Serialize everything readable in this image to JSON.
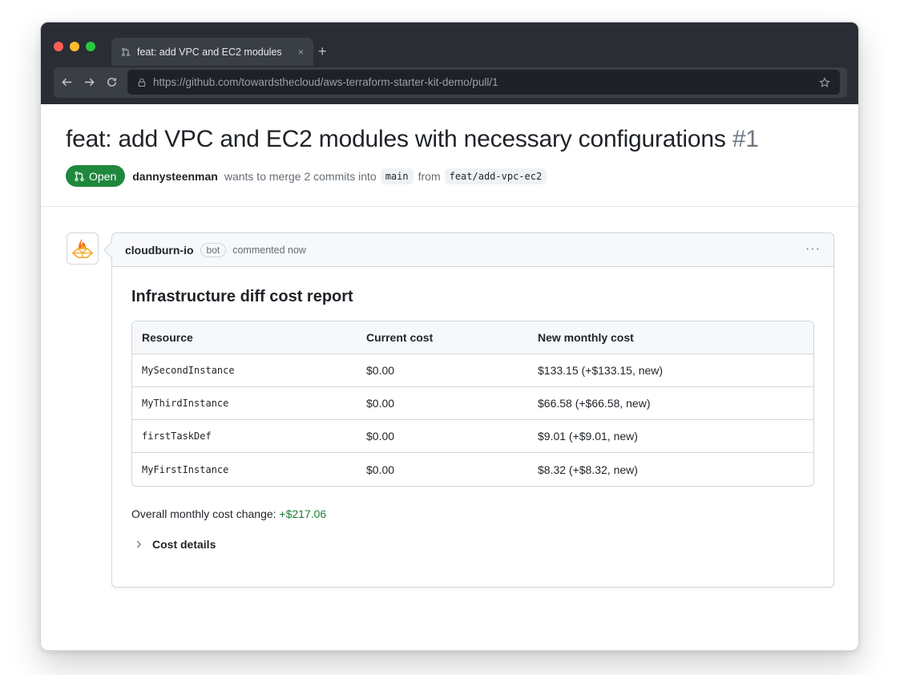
{
  "browser": {
    "tab_title": "feat: add VPC and EC2 modules",
    "tab_close": "×",
    "new_tab": "+",
    "url": "https://github.com/towardsthecloud/aws-terraform-starter-kit-demo/pull/1"
  },
  "pr": {
    "title": "feat: add VPC and EC2 modules with necessary configurations",
    "number": "#1",
    "status": "Open",
    "author": "dannysteenman",
    "merge_text": "wants to merge 2 commits into",
    "base_branch": "main",
    "from_text": "from",
    "head_branch": "feat/add-vpc-ec2"
  },
  "comment": {
    "author": "cloudburn-io",
    "badge": "bot",
    "time": "commented now",
    "menu": "···",
    "report_title": "Infrastructure diff cost report",
    "table": {
      "headers": [
        "Resource",
        "Current cost",
        "New monthly cost"
      ],
      "rows": [
        [
          "MySecondInstance",
          "$0.00",
          "$133.15 (+$133.15, new)"
        ],
        [
          "MyThirdInstance",
          "$0.00",
          "$66.58 (+$66.58, new)"
        ],
        [
          "firstTaskDef",
          "$0.00",
          "$9.01 (+$9.01, new)"
        ],
        [
          "MyFirstInstance",
          "$0.00",
          "$8.32 (+$8.32, new)"
        ]
      ]
    },
    "overall_label": "Overall monthly cost change:",
    "overall_value": "+$217.06",
    "details_label": "Cost details"
  },
  "colors": {
    "open_badge": "#1f883d",
    "positive_change": "#1a7f37",
    "chrome_bg": "#2a2d33"
  },
  "icons": [
    "pull-request-icon",
    "close-icon",
    "plus-icon",
    "back-arrow-icon",
    "forward-arrow-icon",
    "reload-icon",
    "lock-icon",
    "star-icon",
    "cloudburn-logo-icon",
    "kebab-menu-icon",
    "chevron-right-icon"
  ]
}
